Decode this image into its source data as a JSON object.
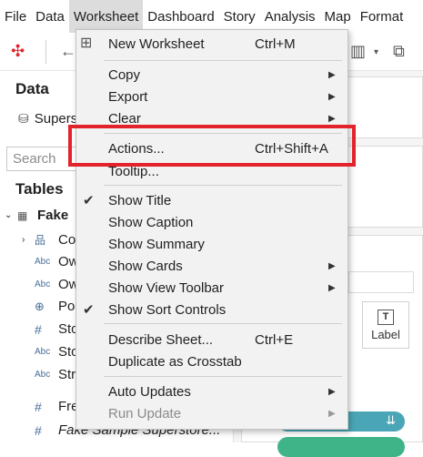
{
  "menubar": {
    "items": [
      "File",
      "Data",
      "Worksheet",
      "Dashboard",
      "Story",
      "Analysis",
      "Map",
      "Format"
    ],
    "active_index": 2
  },
  "datapane": {
    "title": "Data",
    "datasource": "Superstore",
    "search_placeholder": "Search",
    "tables_title": "Tables",
    "table_name": "Fake",
    "fields": [
      {
        "type": "hierarchy",
        "label": "Co"
      },
      {
        "type": "Abc",
        "label": "Ow"
      },
      {
        "type": "Abc",
        "label": "Ow"
      },
      {
        "type": "geo",
        "label": "Po"
      },
      {
        "type": "#",
        "label": "Sto"
      },
      {
        "type": "Abc",
        "label": "Sto"
      },
      {
        "type": "Abc",
        "label": "Str"
      },
      {
        "type": "#",
        "label": "Fre"
      },
      {
        "type": "#",
        "label": "Fake Sample Superstore..."
      }
    ]
  },
  "marks": {
    "label_card": "Label"
  },
  "menu": {
    "items": {
      "new_worksheet": {
        "label": "New Worksheet",
        "shortcut": "Ctrl+M"
      },
      "copy": {
        "label": "Copy"
      },
      "export": {
        "label": "Export"
      },
      "clear": {
        "label": "Clear"
      },
      "actions": {
        "label": "Actions...",
        "shortcut": "Ctrl+Shift+A"
      },
      "tooltip": {
        "label": "Tooltip..."
      },
      "show_title": {
        "label": "Show Title",
        "checked": true
      },
      "show_caption": {
        "label": "Show Caption"
      },
      "show_summary": {
        "label": "Show Summary"
      },
      "show_cards": {
        "label": "Show Cards"
      },
      "show_view_toolbar": {
        "label": "Show View Toolbar"
      },
      "show_sort_controls": {
        "label": "Show Sort Controls",
        "checked": true
      },
      "describe_sheet": {
        "label": "Describe Sheet...",
        "shortcut": "Ctrl+E"
      },
      "duplicate_crosstab": {
        "label": "Duplicate as Crosstab"
      },
      "auto_updates": {
        "label": "Auto Updates"
      },
      "run_update": {
        "label": "Run Update",
        "disabled": true
      }
    },
    "check_glyph": "✔",
    "arrow_glyph": "▶"
  },
  "colors": {
    "highlight": "#e3232b",
    "pill_teal": "#4aa6b6",
    "pill_green": "#3fb489"
  }
}
